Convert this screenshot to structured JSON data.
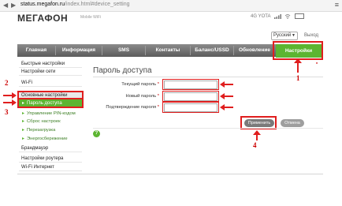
{
  "browser": {
    "url_domain": "status.megafon.ru",
    "url_path": "/index.html#device_setting",
    "menu_glyph": "≡",
    "back_glyph": "◀",
    "forward_glyph": "▶"
  },
  "header": {
    "logo_text": "МЕГАФОН",
    "logo_sub": "Mobile WiFi",
    "network": "4G  YOTA",
    "language": "Русский",
    "logout": "Выход"
  },
  "menu": {
    "items": [
      "Главная",
      "Информация",
      "SMS",
      "Контакты",
      "Баланс/USSD",
      "Обновление"
    ],
    "active": "Настройки"
  },
  "sidebar": {
    "top_items": [
      "Быстрые настройки",
      "Настройки сети",
      "Wi-Fi"
    ],
    "active_group": "Основные настройки",
    "active_item": "Пароль доступа",
    "sub_items": [
      "Управление PIN-кодом",
      "Сброс настроек",
      "Перезагрузка",
      "Энергосбережение"
    ],
    "bottom_items": [
      "Брандмауэр",
      "Настройки роутера",
      "Wi-Fi Интернет"
    ]
  },
  "main": {
    "title": "Пароль доступа",
    "fields": [
      {
        "label": "Текущий пароль",
        "value": ""
      },
      {
        "label": "Новый пароль",
        "value": ""
      },
      {
        "label": "Подтверждение пароля",
        "value": ""
      }
    ],
    "required_mark": "*",
    "apply_button": "Применить",
    "cancel_button": "Отмена",
    "help_glyph": "?"
  },
  "annotations": {
    "n1": "1",
    "n2": "2",
    "n3": "3",
    "n4": "4",
    "dot": "•"
  },
  "colors": {
    "accent_green": "#5cb531",
    "highlight_red": "#e01e1e",
    "menubar_gray": "#6e6e6e"
  }
}
